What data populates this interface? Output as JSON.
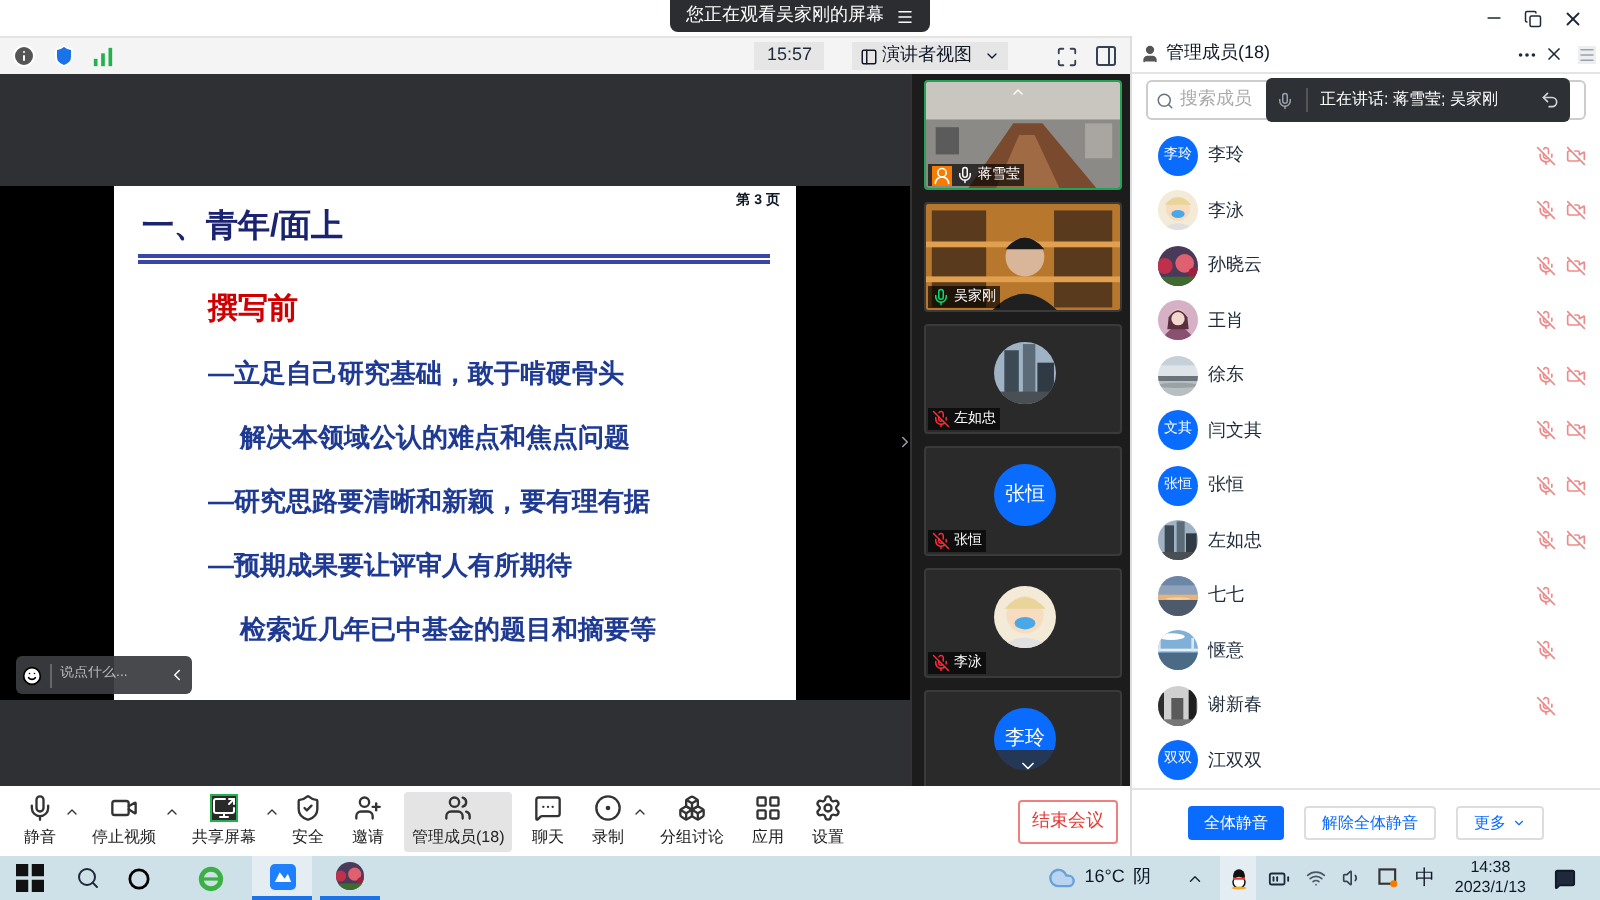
{
  "banner": {
    "text": "您正在观看吴家刚的屏幕"
  },
  "view_bar": {
    "time": "15:57",
    "view_menu": "演讲者视图"
  },
  "slide": {
    "page": "第 3 页",
    "title": "一、青年/面上",
    "lines": [
      {
        "kind": "heading",
        "text": "撰写前"
      },
      {
        "kind": "bullet",
        "text": "—立足自己研究基础，敢于啃硬骨头"
      },
      {
        "kind": "sub",
        "text": "解决本领域公认的难点和焦点问题"
      },
      {
        "kind": "bullet",
        "text": "—研究思路要清晰和新颖，要有理有据"
      },
      {
        "kind": "bullet",
        "text": "—预期成果要让评审人有所期待"
      },
      {
        "kind": "sub",
        "text": "检索近几年已中基金的题目和摘要等"
      }
    ]
  },
  "chat_input": {
    "placeholder": "说点什么..."
  },
  "video_tiles": [
    {
      "kind": "video",
      "name": "蒋雪莹",
      "host": true,
      "mic_muted": false,
      "speaking": false,
      "active": true
    },
    {
      "kind": "video",
      "name": "吴家刚",
      "host": false,
      "mic_muted": false,
      "speaking": true,
      "active": false
    },
    {
      "kind": "avatar_picture",
      "name": "左如忠",
      "host": false,
      "mic_muted": true,
      "active": false
    },
    {
      "kind": "avatar_initials",
      "initials": "张恒",
      "name": "张恒",
      "host": false,
      "mic_muted": true,
      "active": false
    },
    {
      "kind": "avatar_picture",
      "name": "李泳",
      "host": false,
      "mic_muted": true,
      "active": false
    },
    {
      "kind": "avatar_initials",
      "initials": "李玲",
      "active": false
    }
  ],
  "panel": {
    "title": "管理成员(18)",
    "search_placeholder": "搜索成员",
    "speaking": "正在讲话: 蒋雪莹; 吴家刚",
    "members": [
      {
        "name": "李玲",
        "avatar": {
          "kind": "initials",
          "text": "李玲"
        },
        "mic_muted": true,
        "video_muted": true
      },
      {
        "name": "李泳",
        "mic_muted": true,
        "video_muted": true
      },
      {
        "name": "孙晓云",
        "mic_muted": true,
        "video_muted": true
      },
      {
        "name": "王肖",
        "mic_muted": true,
        "video_muted": true
      },
      {
        "name": "徐东",
        "mic_muted": true,
        "video_muted": true
      },
      {
        "name": "闫文其",
        "avatar": {
          "kind": "initials",
          "text": "文其"
        },
        "mic_muted": true,
        "video_muted": true
      },
      {
        "name": "张恒",
        "avatar": {
          "kind": "initials",
          "text": "张恒"
        },
        "mic_muted": true,
        "video_muted": true
      },
      {
        "name": "左如忠",
        "mic_muted": true,
        "video_muted": true
      },
      {
        "name": "七七",
        "mic_muted": true,
        "video_muted": false
      },
      {
        "name": "惬意",
        "mic_muted": true,
        "video_muted": false
      },
      {
        "name": "谢新春",
        "mic_muted": true,
        "video_muted": false
      },
      {
        "name": "江双双",
        "avatar": {
          "kind": "initials",
          "text": "双双"
        },
        "mic_muted": false,
        "video_muted": false
      }
    ],
    "buttons": [
      {
        "label": "全体静音",
        "primary": true,
        "dropdown": false
      },
      {
        "label": "解除全体静音",
        "primary": false,
        "dropdown": false
      },
      {
        "label": "更多",
        "primary": false,
        "dropdown": true
      }
    ]
  },
  "toolbar": {
    "items": [
      {
        "kind": "mic",
        "label": "静音",
        "menu": true,
        "selected": false
      },
      {
        "kind": "video",
        "label": "停止视频",
        "menu": true,
        "selected": false
      },
      {
        "kind": "share",
        "label": "共享屏幕",
        "menu": true,
        "selected": false
      },
      {
        "kind": "security",
        "label": "安全",
        "menu": false,
        "selected": false
      },
      {
        "kind": "invite",
        "label": "邀请",
        "menu": false,
        "selected": false
      },
      {
        "kind": "members",
        "label": "管理成员(18)",
        "menu": false,
        "selected": true
      },
      {
        "kind": "chat",
        "label": "聊天",
        "menu": false,
        "selected": false
      },
      {
        "kind": "record",
        "label": "录制",
        "menu": true,
        "selected": false
      },
      {
        "kind": "breakout",
        "label": "分组讨论",
        "menu": false,
        "selected": false
      },
      {
        "kind": "apps",
        "label": "应用",
        "menu": false,
        "selected": false
      },
      {
        "kind": "settings",
        "label": "设置",
        "menu": false,
        "selected": false
      }
    ],
    "end_button": "结束会议"
  },
  "taskbar": {
    "temperature": "16°C",
    "weather": "阴",
    "input_method": "中",
    "time": "14:38",
    "date": "2023/1/13"
  }
}
